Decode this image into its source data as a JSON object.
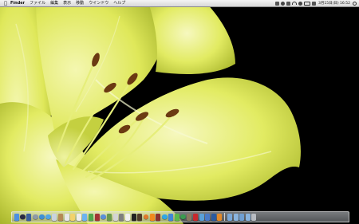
{
  "menubar": {
    "apple_icon": "apple-logo-icon",
    "app_name": "Finder",
    "items": [
      "ファイル",
      "編集",
      "表示",
      "移動",
      "ウインドウ",
      "ヘルプ"
    ],
    "status_icons": [
      "airplay-icon",
      "timemachine-icon",
      "bluetooth-icon",
      "wifi-icon",
      "volume-icon",
      "battery-icon",
      "input-menu-icon"
    ],
    "clock": "3月15日(日) 16:52",
    "spotlight_icon": "spotlight-search-icon"
  },
  "desktop": {
    "wallpaper": "yellow-daylily-macro",
    "colors": {
      "petal": "#e3ec62",
      "petal_light": "#f4f7b5",
      "background": "#000000",
      "anther": "#6b3a12"
    }
  },
  "dock": {
    "icons": [
      {
        "name": "finder-icon",
        "color": "#4a90e2"
      },
      {
        "name": "dashboard-icon",
        "color": "#2a2a44"
      },
      {
        "name": "mission-control-icon",
        "color": "#3a5f9e"
      },
      {
        "name": "launchpad-icon",
        "color": "#8e9aa8"
      },
      {
        "name": "app-store-icon",
        "color": "#3d8fd6"
      },
      {
        "name": "safari-icon",
        "color": "#4fa5e8"
      },
      {
        "name": "mail-icon",
        "color": "#c9d3de"
      },
      {
        "name": "contacts-icon",
        "color": "#b58a54"
      },
      {
        "name": "calendar-icon",
        "color": "#e8e8e8"
      },
      {
        "name": "notes-icon",
        "color": "#f2d36b"
      },
      {
        "name": "reminders-icon",
        "color": "#eeeeee"
      },
      {
        "name": "messages-icon",
        "color": "#6bb3f0"
      },
      {
        "name": "facetime-icon",
        "color": "#4fa84a"
      },
      {
        "name": "photo-booth-icon",
        "color": "#a33434"
      },
      {
        "name": "itunes-icon",
        "color": "#5a8fd8"
      },
      {
        "name": "iphoto-icon",
        "color": "#6a9a4a"
      },
      {
        "name": "preview-icon",
        "color": "#d4d4d4"
      },
      {
        "name": "system-preferences-icon",
        "color": "#7f7f7f"
      },
      {
        "name": "textedit-icon",
        "color": "#f0f0f0"
      },
      {
        "name": "terminal-icon",
        "color": "#222222"
      },
      {
        "name": "chess-icon",
        "color": "#4f3b2a"
      },
      {
        "name": "firefox-icon",
        "color": "#e07a2c"
      },
      {
        "name": "vlc-icon",
        "color": "#f08a1e"
      },
      {
        "name": "dictionary-icon",
        "color": "#8a3030"
      },
      {
        "name": "skype-icon",
        "color": "#2fa8e6"
      },
      {
        "name": "dropbox-icon",
        "color": "#3f85d8"
      },
      {
        "name": "evernote-icon",
        "color": "#5bb84a"
      },
      {
        "name": "chrome-icon",
        "color": "#3a9b50"
      },
      {
        "name": "gimp-icon",
        "color": "#8a7a60"
      },
      {
        "name": "flash-icon",
        "color": "#c8282d"
      },
      {
        "name": "utilities-icon",
        "color": "#5aa0d8"
      },
      {
        "name": "xcode-icon",
        "color": "#4a7ac8"
      },
      {
        "name": "photoshop-icon",
        "color": "#2a5aa0"
      },
      {
        "name": "illustrator-icon",
        "color": "#e28a2a"
      },
      {
        "name": "applications-folder-icon",
        "color": "#7aa8d8"
      },
      {
        "name": "documents-folder-icon",
        "color": "#8ab4de"
      },
      {
        "name": "downloads-folder-icon",
        "color": "#6f9fd2"
      },
      {
        "name": "folder-icon",
        "color": "#8ab4de"
      },
      {
        "name": "trash-icon",
        "color": "#b8bcc2"
      }
    ],
    "separator_before_index": 34
  }
}
